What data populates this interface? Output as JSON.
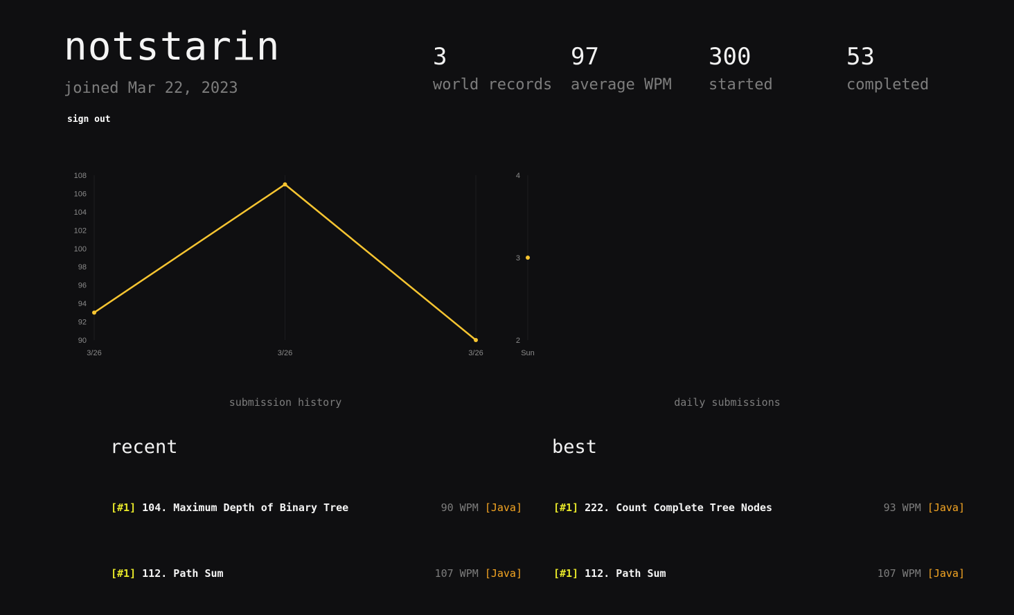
{
  "profile": {
    "username": "notstarin",
    "joined": "joined Mar 22, 2023",
    "sign_out": "sign out"
  },
  "stats": [
    {
      "value": "3",
      "label": "world records"
    },
    {
      "value": "97",
      "label": "average WPM"
    },
    {
      "value": "300",
      "label": "started"
    },
    {
      "value": "53",
      "label": "completed"
    }
  ],
  "colors": {
    "background": "#0f0f11",
    "accent_line": "#f7c531",
    "rank": "#e6e629",
    "language": "#f5a623",
    "muted": "#7d7d7d"
  },
  "charts": {
    "history_caption": "submission history",
    "daily_caption": "daily submissions"
  },
  "chart_data": [
    {
      "type": "line",
      "x": [
        "3/26",
        "3/26",
        "3/26"
      ],
      "values": [
        93,
        107,
        90
      ],
      "ylim": [
        90,
        108
      ],
      "yticks": [
        "108",
        "106",
        "104",
        "102",
        "100",
        "98",
        "96",
        "94",
        "92",
        "90"
      ],
      "title": "submission history",
      "grid": true
    },
    {
      "type": "scatter",
      "x": [
        "Sun"
      ],
      "values": [
        3
      ],
      "ylim": [
        2,
        4
      ],
      "yticks": [
        "4",
        "3",
        "2"
      ],
      "title": "daily submissions",
      "grid": true
    }
  ],
  "recent": {
    "title": "recent",
    "items": [
      {
        "rank": "[#1]",
        "name": "104. Maximum Depth of Binary Tree",
        "wpm": "90 WPM",
        "lang": "[Java]"
      },
      {
        "rank": "[#1]",
        "name": "112. Path Sum",
        "wpm": "107 WPM",
        "lang": "[Java]"
      }
    ]
  },
  "best": {
    "title": "best",
    "items": [
      {
        "rank": "[#1]",
        "name": "222. Count Complete Tree Nodes",
        "wpm": "93 WPM",
        "lang": "[Java]"
      },
      {
        "rank": "[#1]",
        "name": "112. Path Sum",
        "wpm": "107 WPM",
        "lang": "[Java]"
      }
    ]
  }
}
